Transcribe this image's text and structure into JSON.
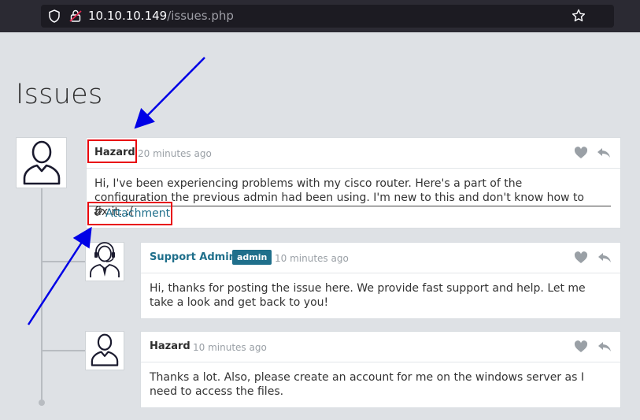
{
  "browser": {
    "url_host": "10.10.10.149",
    "url_path": "/issues.php"
  },
  "page": {
    "title": "Issues"
  },
  "posts": [
    {
      "author": "Hazard",
      "time": "20 minutes ago",
      "text": "Hi, I've been experiencing problems with my cisco router. Here's a part of the configuration the previous admin had been using. I'm new to this and don't know how to fix it. :(",
      "attachment_label": "Attachment",
      "avatar": "user-outline-icon"
    },
    {
      "author": "Support Admin",
      "badge": "admin",
      "time": "10 minutes ago",
      "text": "Hi, thanks for posting the issue here. We provide fast support and help. Let me take a look and get back to you!",
      "avatar": "support-agent-icon"
    },
    {
      "author": "Hazard",
      "time": "10 minutes ago",
      "text": "Thanks a lot. Also, please create an account for me on the windows server as I need to access the files.",
      "avatar": "user-outline-icon"
    }
  ],
  "colors": {
    "author_main": "#2e2e2e",
    "author_link": "#1f6f8b",
    "badge_bg": "#1f6f8b",
    "annotation_red": "#e8000b",
    "annotation_blue": "#0000e6"
  }
}
